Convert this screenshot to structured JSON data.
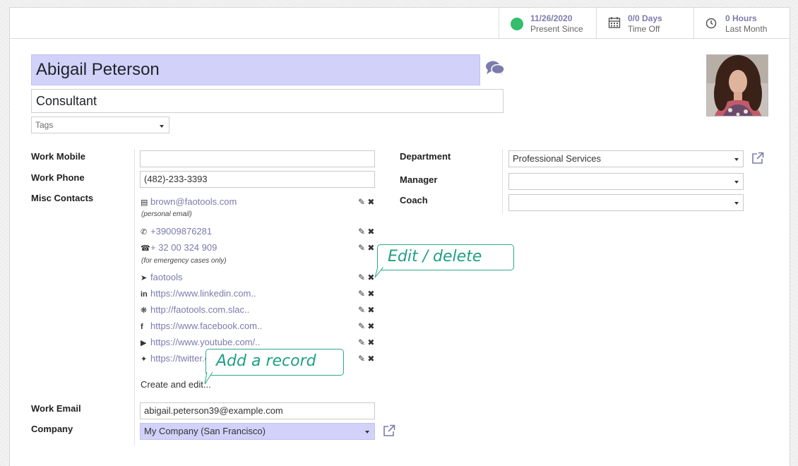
{
  "stats": {
    "presence": {
      "value": "11/26/2020",
      "label": "Present Since",
      "color": "#34bd6a"
    },
    "time_off": {
      "value": "0/0 Days",
      "label": "Time Off",
      "icon": "calendar-icon"
    },
    "hours": {
      "value": "0 Hours",
      "label": "Last Month",
      "icon": "clock-icon"
    }
  },
  "employee": {
    "name": "Abigail Peterson",
    "job_title": "Consultant",
    "tags_placeholder": "Tags"
  },
  "labels": {
    "work_mobile": "Work Mobile",
    "work_phone": "Work Phone",
    "misc_contacts": "Misc Contacts",
    "work_email": "Work Email",
    "company": "Company",
    "department": "Department",
    "manager": "Manager",
    "coach": "Coach"
  },
  "values": {
    "work_mobile": "",
    "work_phone": "(482)-233-3393",
    "work_email": "abigail.peterson39@example.com",
    "company": "My Company (San Francisco)",
    "department": "Professional Services",
    "manager": "",
    "coach": ""
  },
  "contacts": [
    {
      "icon": "envelope-icon",
      "text": "brown@faotools.com",
      "note": "(personal email)"
    },
    {
      "icon": "whatsapp-icon",
      "text": "+39009876281",
      "note": ""
    },
    {
      "icon": "phone-icon",
      "text": "+ 32 00 324 909",
      "note": "(for emergency cases only)"
    },
    {
      "icon": "telegram-icon",
      "text": "faotools",
      "note": ""
    },
    {
      "icon": "linkedin-icon",
      "text": "https://www.linkedin.com..",
      "note": ""
    },
    {
      "icon": "slack-icon",
      "text": "http://faotools.com.slac..",
      "note": ""
    },
    {
      "icon": "facebook-icon",
      "text": "https://www.facebook.com..",
      "note": ""
    },
    {
      "icon": "youtube-icon",
      "text": "https://www.youtube.com/..",
      "note": ""
    },
    {
      "icon": "twitter-icon",
      "text": "https://twitter.c",
      "note": ""
    }
  ],
  "create_and_edit": "Create and edit...",
  "callouts": {
    "edit_delete": "Edit / delete",
    "add_record": "Add a record"
  },
  "colors": {
    "accent": "#7c7bad",
    "name_bg": "#d1d1fa",
    "callout": "#2ba88c"
  }
}
